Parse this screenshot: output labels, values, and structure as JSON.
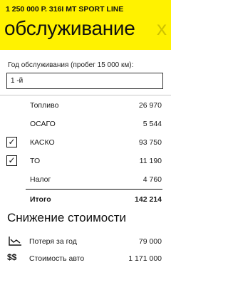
{
  "header": {
    "subtitle": "1 250 000 Р.  316I MT SPORT LINE",
    "title": "обслуживание",
    "next_title_peek": "х"
  },
  "form": {
    "year_label": "Год обслуживания (пробег 15 000 км):",
    "year_value": "1 -й"
  },
  "costs": [
    {
      "label": "Топливо",
      "value": "26 970",
      "checkbox": false
    },
    {
      "label": "ОСАГО",
      "value": "5 544",
      "checkbox": false
    },
    {
      "label": "КАСКО",
      "value": "93 750",
      "checkbox": true,
      "checked": true
    },
    {
      "label": "ТО",
      "value": "11 190",
      "checkbox": true,
      "checked": true
    },
    {
      "label": "Налог",
      "value": "4 760",
      "checkbox": false
    }
  ],
  "total": {
    "label": "Итого",
    "value": "142 214"
  },
  "depreciation": {
    "title": "Снижение стоимости",
    "rows": [
      {
        "label": "Потеря за год",
        "value": "79 000",
        "icon": "chart-icon"
      },
      {
        "label": "Стоимость авто",
        "value": "1 171 000",
        "icon": "dollar-icon"
      }
    ]
  },
  "colors": {
    "accent": "#fff200",
    "text": "#111111",
    "separator": "#c8c8c8"
  }
}
